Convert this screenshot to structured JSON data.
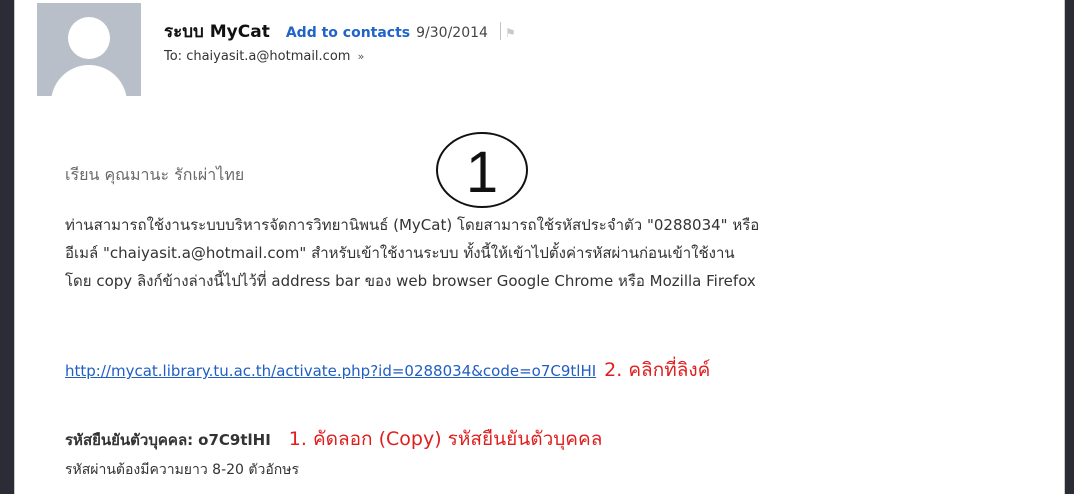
{
  "header": {
    "sender_name": "ระบบ MyCat",
    "add_to_contacts": "Add to contacts",
    "date": "9/30/2014",
    "to_line": "To: chaiyasit.a@hotmail.com",
    "to_chevron": "»"
  },
  "annotation": {
    "circle_number": "1"
  },
  "message": {
    "greeting": "เรียน คุณมานะ รักเผ่าไทย",
    "paragraph_lines": [
      "ท่านสามารถใช้งานระบบบริหารจัดการวิทยานิพนธ์ (MyCat) โดยสามารถใช้รหัสประจำตัว \"0288034\" หรือ",
      "อีเมล์ \"chaiyasit.a@hotmail.com\" สำหรับเข้าใช้งานระบบ ทั้งนี้ให้เข้าไปตั้งค่ารหัสผ่านก่อนเข้าใช้งาน",
      "โดย copy ลิงก์ข้างล่างนี้ไปไว้ที่ address bar ของ web browser Google Chrome หรือ Mozilla Firefox"
    ],
    "activation_link": "http://mycat.library.tu.ac.th/activate.php?id=0288034&code=o7C9tlHI",
    "link_note": "2. คลิกที่ลิงค์",
    "code_label": "รหัสยืนยันตัวบุคคล:",
    "code_value": "o7C9tlHI",
    "code_note": "1. คัดลอก (Copy) รหัสยืนยันตัวบุคคล",
    "password_rule": "รหัสผ่านต้องมีความยาว 8-20 ตัวอักษร"
  },
  "colors": {
    "link": "#1f5ec2",
    "annotation_red": "#e01e1e",
    "background_dark": "#2b2d36"
  },
  "icons": [
    "avatar-placeholder-icon",
    "flag-icon",
    "chevron-down-icon"
  ]
}
